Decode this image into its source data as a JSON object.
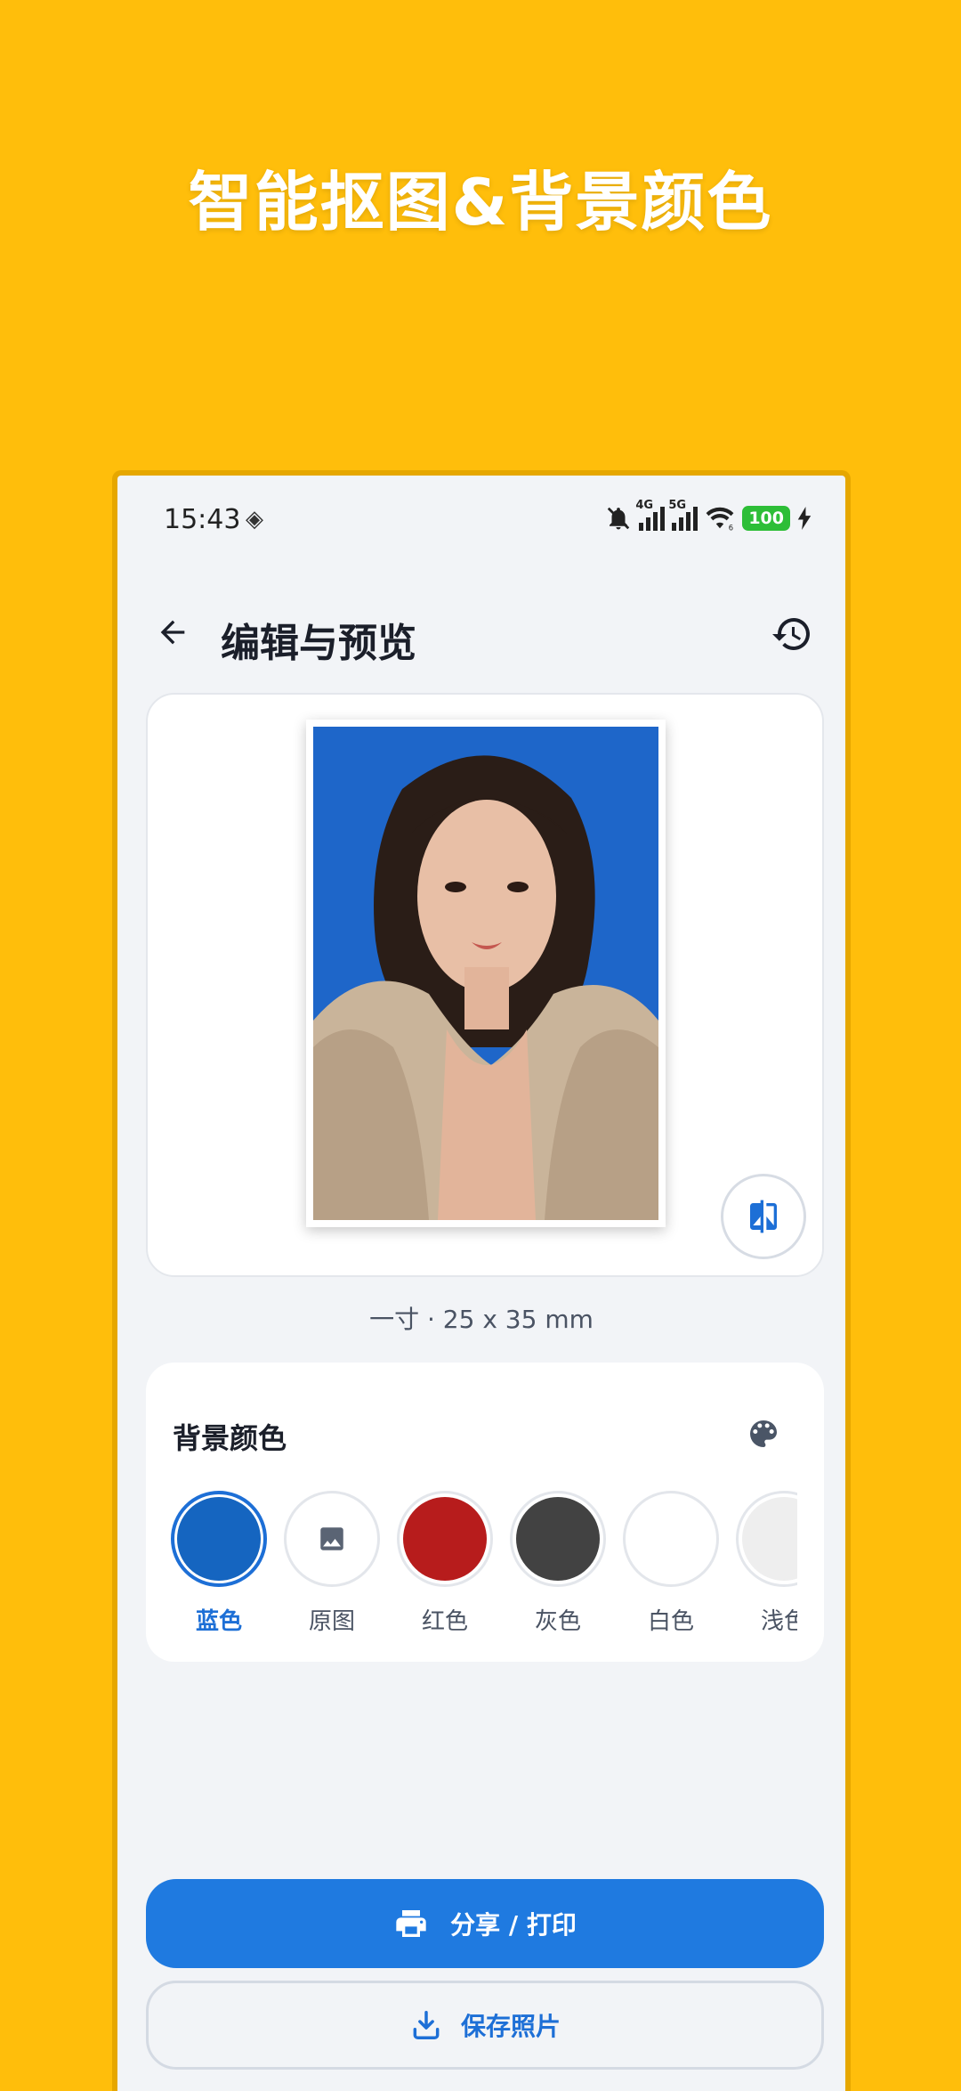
{
  "promo": {
    "headline": "智能抠图&背景颜色"
  },
  "status_bar": {
    "time": "15:43",
    "signal_1_tag": "4G",
    "signal_2_tag": "5G",
    "wifi_tag": "6",
    "battery": "100"
  },
  "app_bar": {
    "title": "编辑与预览"
  },
  "preview": {
    "size_label": "一寸 · 25 x 35 mm"
  },
  "background_color": {
    "title": "背景颜色",
    "swatches": [
      {
        "label": "蓝色",
        "color": "#1565C0",
        "selected": true
      },
      {
        "label": "原图",
        "icon": "image-icon"
      },
      {
        "label": "红色",
        "color": "#B71C1C"
      },
      {
        "label": "灰色",
        "color": "#424242"
      },
      {
        "label": "白色",
        "color": "#FFFFFF"
      },
      {
        "label": "浅色",
        "color": "#EEEEEE"
      }
    ]
  },
  "actions": {
    "share_label": "分享 / 打印",
    "save_label": "保存照片"
  },
  "colors": {
    "page_background": "#FFBE0B",
    "accent": "#1F7AE0",
    "photo_background": "#1E66C9"
  }
}
